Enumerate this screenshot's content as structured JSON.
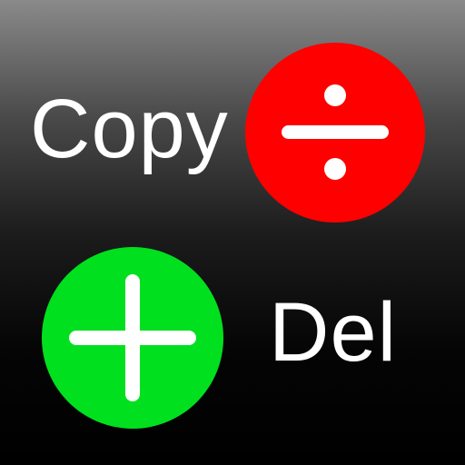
{
  "labels": {
    "copy": "Copy",
    "del": "Del"
  },
  "icons": {
    "top_right": "divide-icon",
    "bottom_left": "plus-icon"
  },
  "colors": {
    "divide_fill": "#ff0000",
    "plus_fill": "#00e01f",
    "glyph": "#ffffff",
    "text": "#ffffff"
  }
}
